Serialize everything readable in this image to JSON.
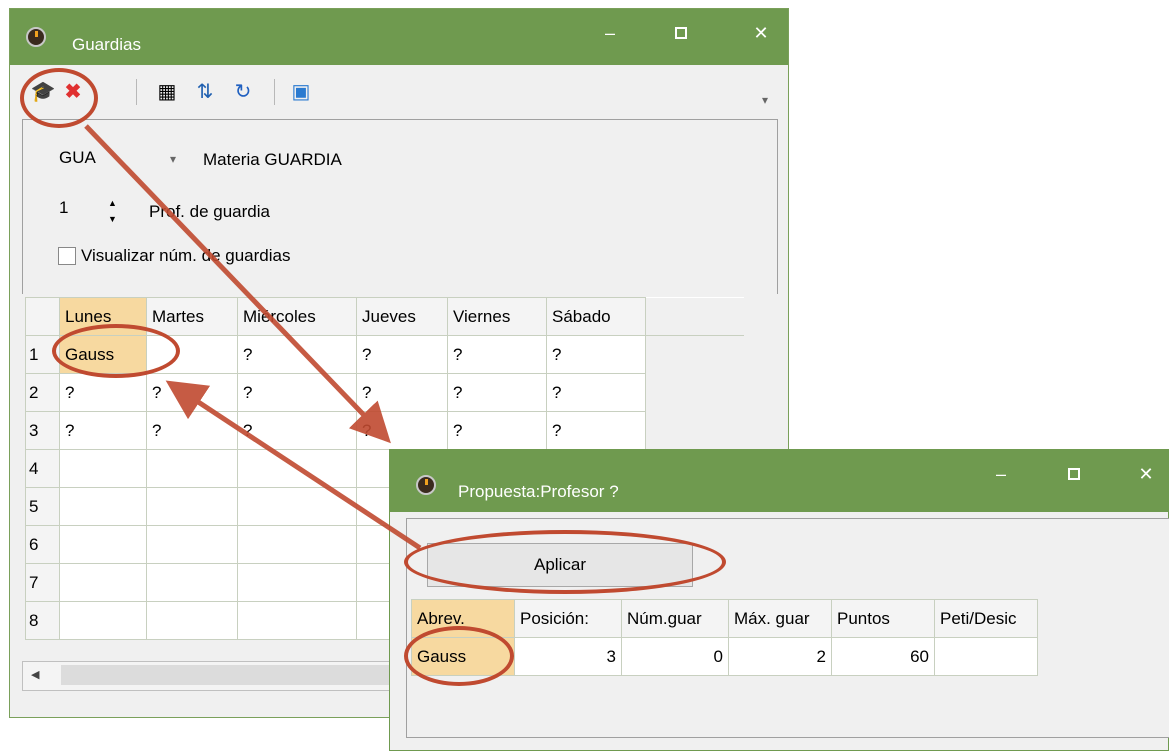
{
  "main_window": {
    "title": "Guardias",
    "controls": {
      "minimize": "‒",
      "close": "✕"
    },
    "materia": {
      "code": "GUA",
      "label": "Materia GUARDIA"
    },
    "prof": {
      "value": "1",
      "label": "Prof. de guardia"
    },
    "visualizar_label": "Visualizar núm. de guardias",
    "grid": {
      "columns": [
        "Lunes",
        "Martes",
        "Miércoles",
        "Jueves",
        "Viernes",
        "Sábado"
      ],
      "rows": [
        {
          "n": "1",
          "cells": [
            "Gauss",
            "",
            "?",
            "?",
            "?",
            "?"
          ]
        },
        {
          "n": "2",
          "cells": [
            "?",
            "?",
            "?",
            "?",
            "?",
            "?"
          ]
        },
        {
          "n": "3",
          "cells": [
            "?",
            "?",
            "?",
            "?",
            "?",
            "?"
          ]
        },
        {
          "n": "4",
          "cells": [
            "",
            "",
            "",
            "",
            "",
            ""
          ]
        },
        {
          "n": "5",
          "cells": [
            "",
            "",
            "",
            "",
            "",
            ""
          ]
        },
        {
          "n": "6",
          "cells": [
            "",
            "",
            "",
            "",
            "",
            ""
          ]
        },
        {
          "n": "7",
          "cells": [
            "",
            "",
            "",
            "",
            "",
            ""
          ]
        },
        {
          "n": "8",
          "cells": [
            "",
            "",
            "",
            "",
            "",
            ""
          ]
        }
      ]
    },
    "scroll_left": "◀"
  },
  "popup": {
    "title": "Propuesta:Profesor ?",
    "controls": {
      "minimize": "‒",
      "close": "✕"
    },
    "aplicar_label": "Aplicar",
    "columns": [
      "Abrev.",
      "Posición:",
      "Núm.guar",
      "Máx. guar",
      "Puntos",
      "Peti/Desic"
    ],
    "rows": [
      {
        "cells": [
          "Gauss",
          "3",
          "0",
          "2",
          "60",
          ""
        ]
      }
    ]
  },
  "icons": [
    "clock-icon",
    "teacher-cap-icon",
    "delete-icon",
    "calculator-icon",
    "transfer-icon",
    "refresh-icon",
    "export-icon",
    "chevron-down-icon"
  ],
  "annotation_color": "#c04a30"
}
